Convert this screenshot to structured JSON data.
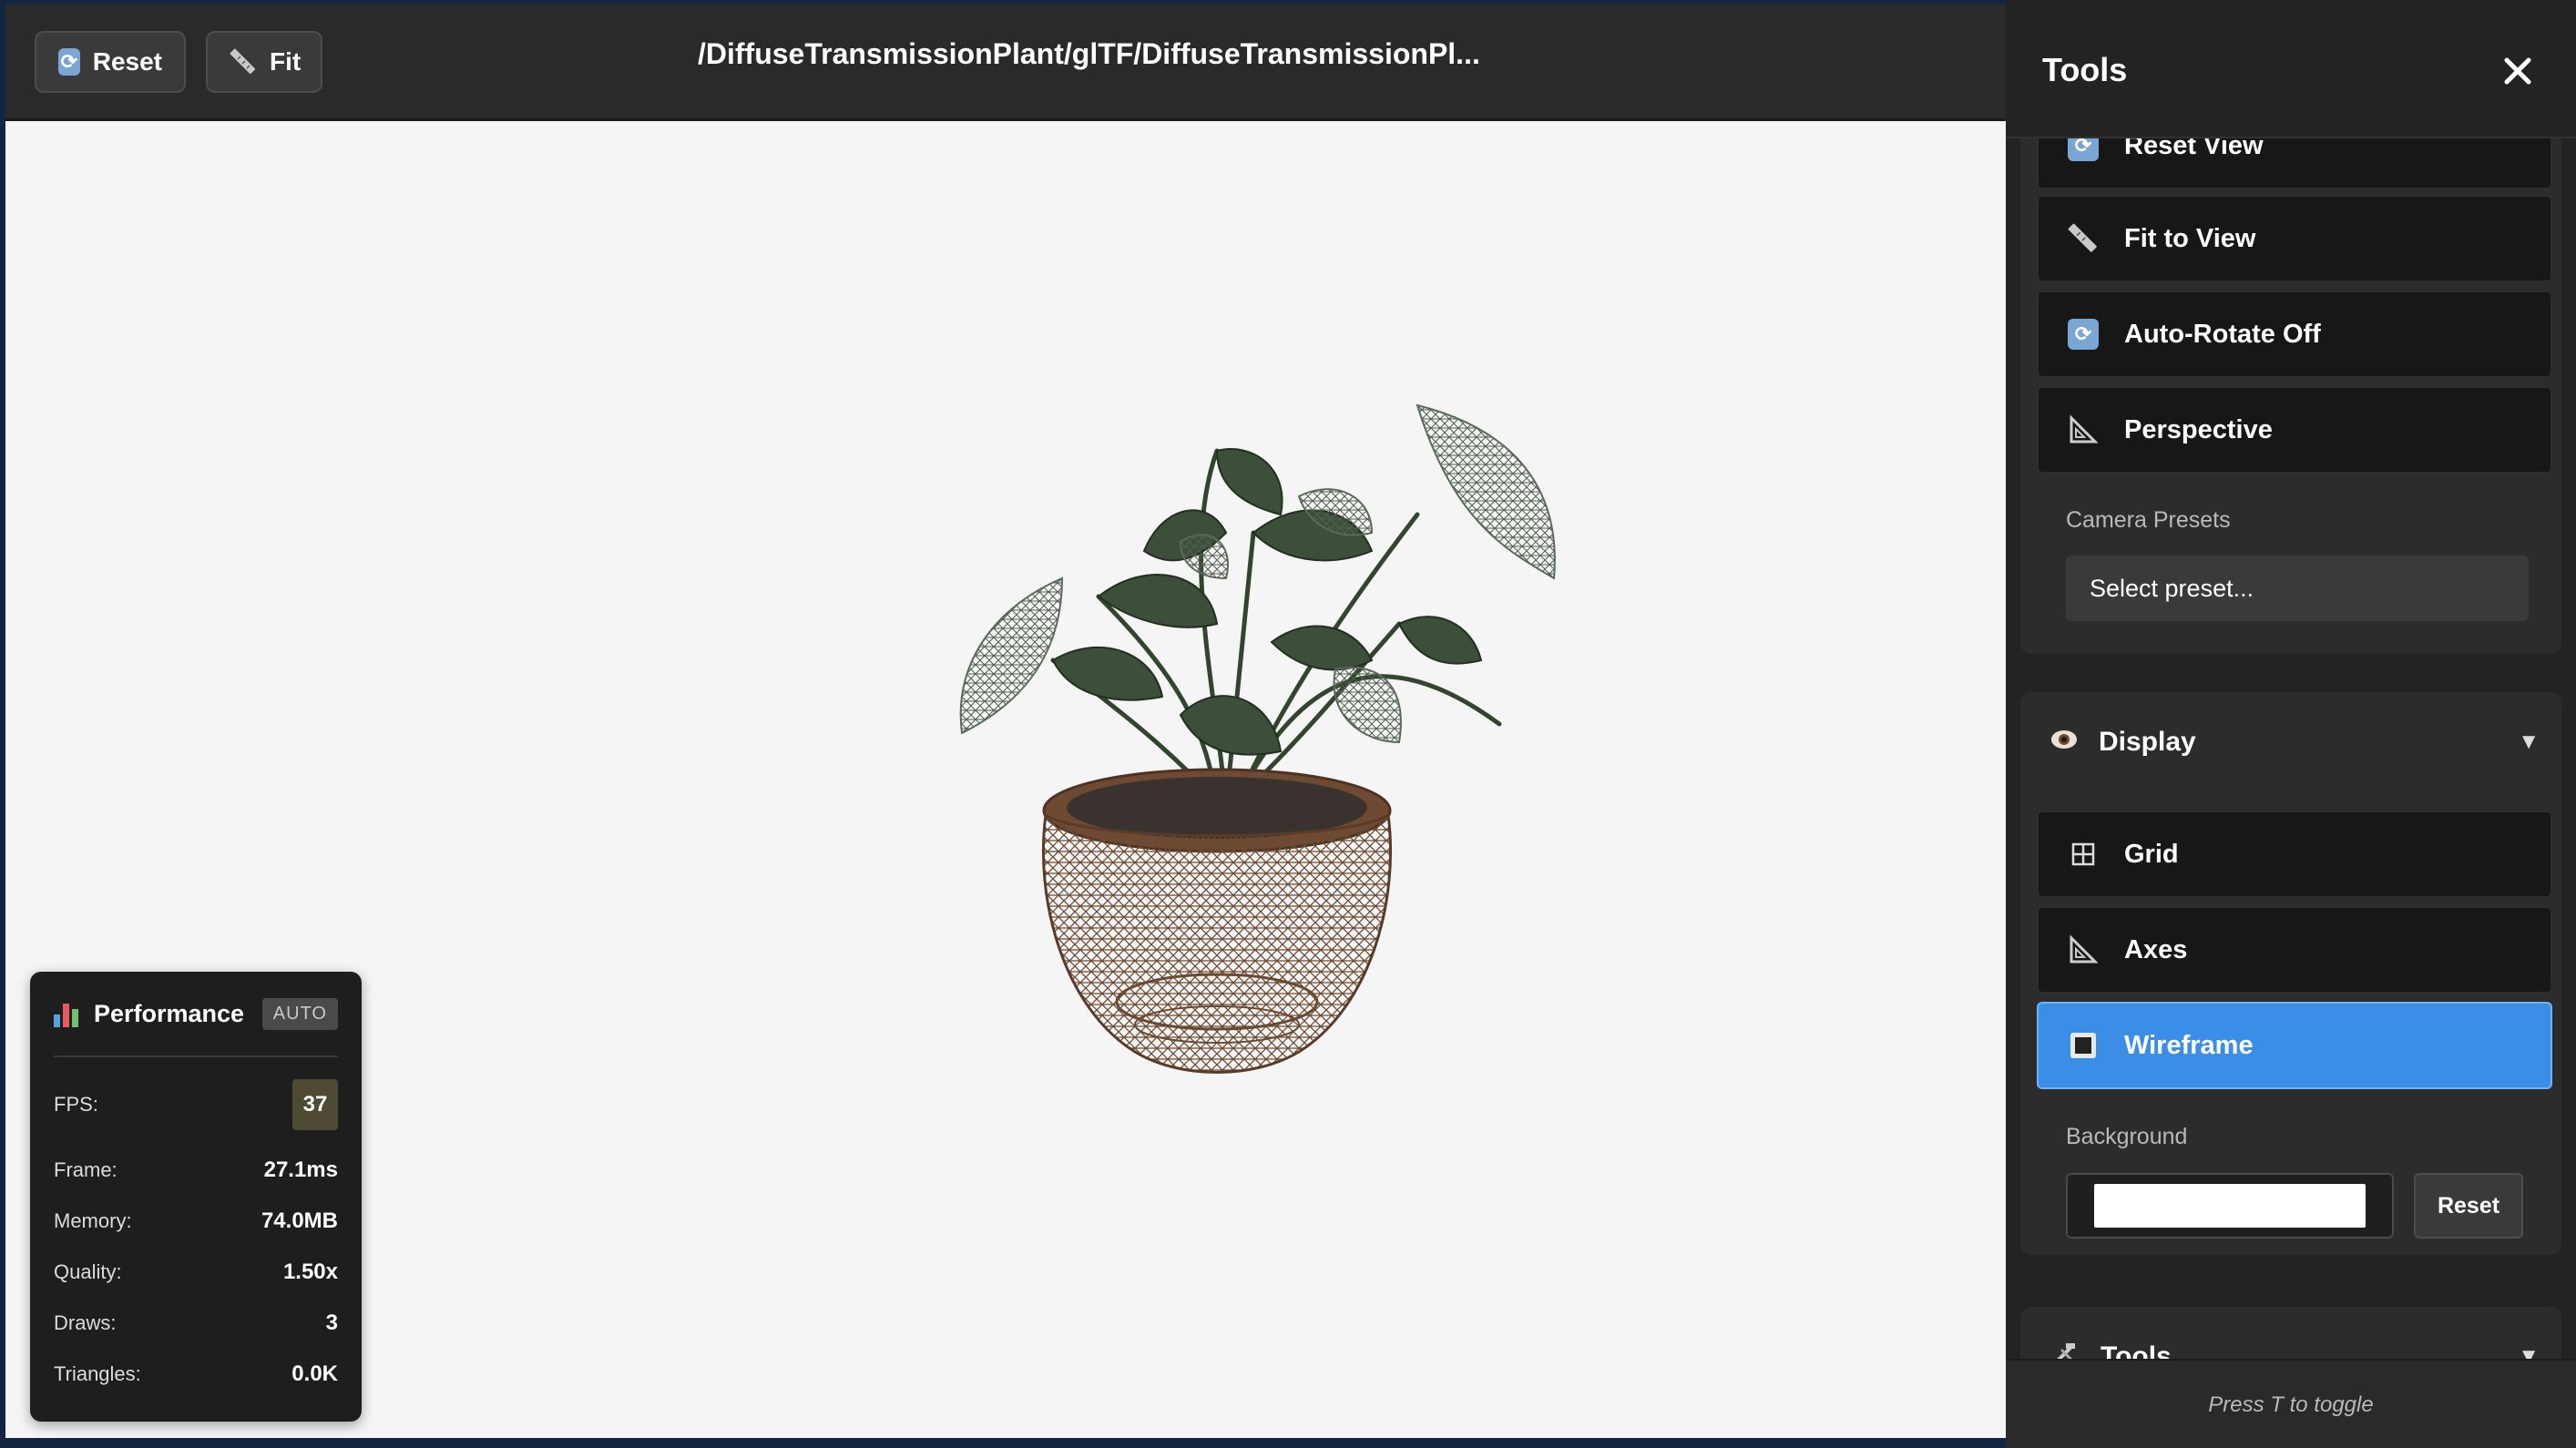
{
  "viewer": {
    "reset_label": "Reset",
    "fit_label": "Fit",
    "path_title": "/DiffuseTransmissionPlant/glTF/DiffuseTransmissionPl...",
    "background_color": "#f5f5f5"
  },
  "performance": {
    "title": "Performance",
    "badge": "AUTO",
    "fps_label": "FPS:",
    "fps_value": "37",
    "frame_label": "Frame:",
    "frame_value": "27.1ms",
    "memory_label": "Memory:",
    "memory_value": "74.0MB",
    "quality_label": "Quality:",
    "quality_value": "1.50x",
    "draws_label": "Draws:",
    "draws_value": "3",
    "triangles_label": "Triangles:",
    "triangles_value": "0.0K"
  },
  "sidebar": {
    "title": "Tools",
    "camera": {
      "reset_view": "Reset View",
      "fit_to_view": "Fit to View",
      "auto_rotate": "Auto-Rotate Off",
      "perspective": "Perspective",
      "presets_label": "Camera Presets",
      "preset_placeholder": "Select preset..."
    },
    "display": {
      "title": "Display",
      "grid": "Grid",
      "axes": "Axes",
      "wireframe": "Wireframe",
      "wireframe_active": true,
      "background_label": "Background",
      "background_value": "#ffffff",
      "background_reset": "Reset"
    },
    "tools_section": {
      "title": "Tools"
    },
    "footer_hint": "Press T to toggle"
  },
  "colors": {
    "accent": "#3a8ee6",
    "panel": "#232324",
    "card": "#2c2c2d"
  }
}
